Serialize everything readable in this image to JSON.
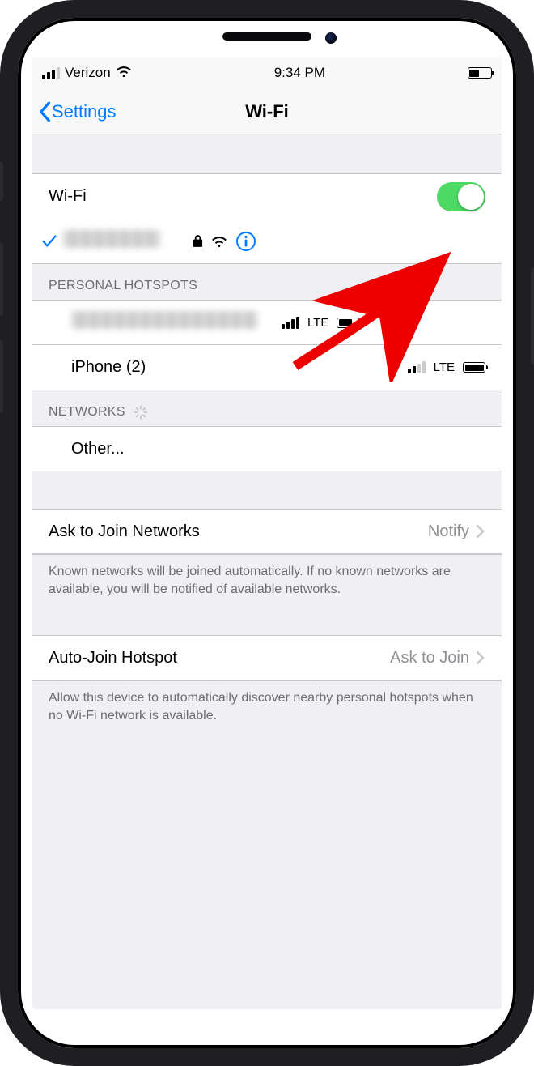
{
  "status_bar": {
    "carrier": "Verizon",
    "time": "9:34 PM"
  },
  "nav": {
    "back_label": "Settings",
    "title": "Wi-Fi"
  },
  "wifi_toggle": {
    "label": "Wi-Fi",
    "on": true
  },
  "connected_network": {
    "name_hidden": true,
    "secure": true
  },
  "sections": {
    "personal_hotspots": "PERSONAL HOTSPOTS",
    "networks": "NETWORKS"
  },
  "hotspots": [
    {
      "name_hidden": true,
      "signal_bars": 4,
      "tech": "LTE",
      "battery_pct": 60
    },
    {
      "name": "iPhone (2)",
      "signal_bars": 2,
      "tech": "LTE",
      "battery_pct": 95
    }
  ],
  "other_row": {
    "label": "Other..."
  },
  "ask_to_join": {
    "label": "Ask to Join Networks",
    "value": "Notify",
    "footer": "Known networks will be joined automatically. If no known networks are available, you will be notified of available networks."
  },
  "auto_join_hotspot": {
    "label": "Auto-Join Hotspot",
    "value": "Ask to Join",
    "footer": "Allow this device to automatically discover nearby personal hotspots when no Wi-Fi network is available."
  }
}
